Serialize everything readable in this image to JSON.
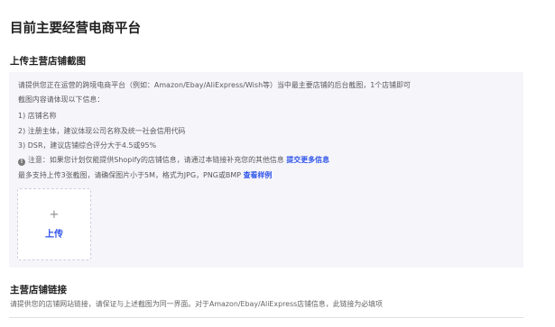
{
  "page": {
    "title": "目前主要经营电商平台"
  },
  "upload_section": {
    "title": "上传主营店铺截图",
    "intro": "请提供您正在运营的跨境电商平台（例如：Amazon/Ebay/AliExpress/Wish等）当中最主要店铺的后台截图，1个店铺即可",
    "requirements_heading": "截图内容请体现以下信息：",
    "requirements": [
      "1) 店铺名称",
      "2) 注册主体，建议体现公司名称及统一社会信用代码",
      "3) DSR，建议店铺综合评分大于4.5或95%"
    ],
    "notice": {
      "icon": "info-icon",
      "text": "注意：如果您计划仅能提供Shopify的店铺信息，请通过本链接补充您的其他信息",
      "link": "提交更多信息"
    },
    "limits": {
      "text": "最多支持上传3张截图，请确保图片小于5M，格式为JPG，PNG或BMP",
      "link": "查看样例"
    },
    "upload_button": {
      "plus": "+",
      "label": "上传"
    }
  },
  "link_section": {
    "title": "主营店铺链接",
    "description": "请提供您的店铺网站链接，请保证与上述截图为同一界面。对于Amazon/Ebay/AliExpress店铺信息，此链接为必填项"
  }
}
